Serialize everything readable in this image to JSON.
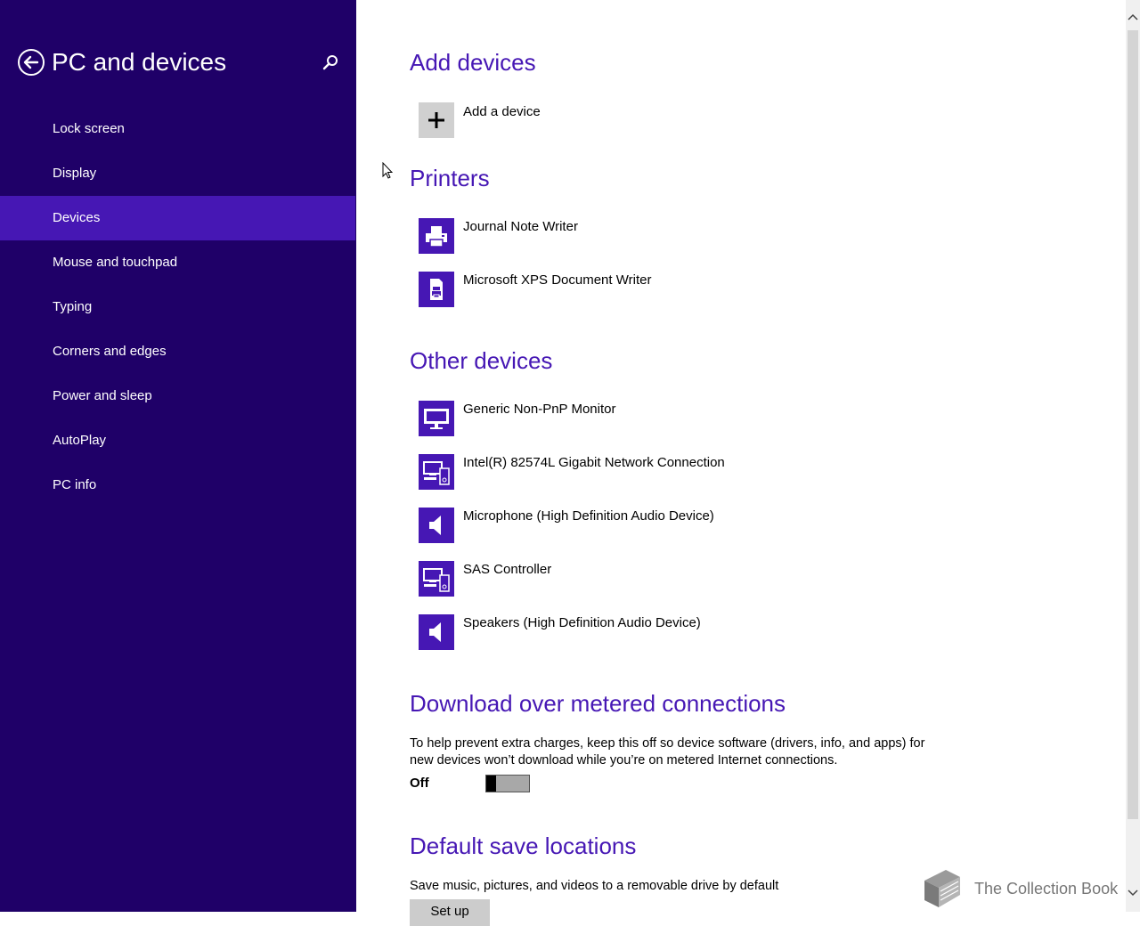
{
  "sidebar": {
    "title": "PC and devices",
    "items": [
      {
        "label": "Lock screen"
      },
      {
        "label": "Display"
      },
      {
        "label": "Devices",
        "active": true
      },
      {
        "label": "Mouse and touchpad"
      },
      {
        "label": "Typing"
      },
      {
        "label": "Corners and edges"
      },
      {
        "label": "Power and sleep"
      },
      {
        "label": "AutoPlay"
      },
      {
        "label": "PC info"
      }
    ]
  },
  "add_devices": {
    "title": "Add devices",
    "add_label": "Add a device",
    "icon": "plus-icon"
  },
  "printers": {
    "title": "Printers",
    "items": [
      {
        "label": "Journal Note Writer",
        "icon": "printer-icon"
      },
      {
        "label": "Microsoft XPS Document Writer",
        "icon": "document-printer-icon"
      }
    ]
  },
  "other_devices": {
    "title": "Other devices",
    "items": [
      {
        "label": "Generic Non-PnP Monitor",
        "icon": "monitor-icon"
      },
      {
        "label": "Intel(R) 82574L Gigabit Network Connection",
        "icon": "devices-icon"
      },
      {
        "label": "Microphone (High Definition Audio Device)",
        "icon": "speaker-icon"
      },
      {
        "label": "SAS Controller",
        "icon": "devices-icon"
      },
      {
        "label": "Speakers (High Definition Audio Device)",
        "icon": "speaker-icon"
      }
    ]
  },
  "metered": {
    "title": "Download over metered connections",
    "description": "To help prevent extra charges, keep this off so device software (drivers, info, and apps) for new devices won’t download while you’re on metered Internet connections.",
    "toggle_label": "Off",
    "toggle_on": false
  },
  "save_locations": {
    "title": "Default save locations",
    "description": "Save music, pictures, and videos to a removable drive by default",
    "button_label": "Set up"
  },
  "watermark": {
    "text": "The Collection Book"
  },
  "colors": {
    "sidebar_bg": "#1f0068",
    "accent": "#4617b4",
    "active_item": "#4617b4"
  }
}
